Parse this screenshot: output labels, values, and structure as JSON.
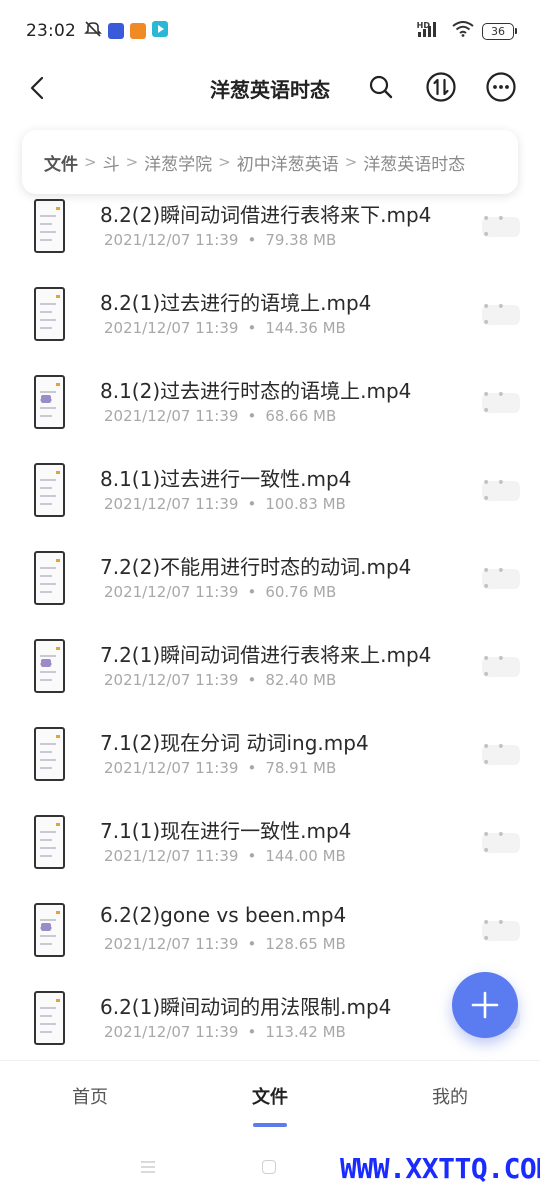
{
  "status_bar": {
    "time": "23:02",
    "network_label": "HD",
    "battery": "36",
    "icons": [
      "mute-icon",
      "app-notify-icon",
      "app-notify-icon-2",
      "play-store-icon",
      "signal-icon",
      "wifi-icon"
    ]
  },
  "title_bar": {
    "title": "洋葱英语时态",
    "icons": [
      "back-icon",
      "search-icon",
      "sort-icon",
      "more-icon"
    ]
  },
  "breadcrumb": {
    "items": [
      "文件",
      "斗",
      "洋葱学院",
      "初中洋葱英语",
      "洋葱英语时态"
    ],
    "separator": ">"
  },
  "files": [
    {
      "name": "8.2(2)瞬间动词借进行表将来下.mp4",
      "date": "2021/12/07 11:39",
      "size": "79.38 MB"
    },
    {
      "name": "8.2(1)过去进行的语境上.mp4",
      "date": "2021/12/07 11:39",
      "size": "144.36 MB"
    },
    {
      "name": "8.1(2)过去进行时态的语境上.mp4",
      "date": "2021/12/07 11:39",
      "size": "68.66 MB"
    },
    {
      "name": "8.1(1)过去进行一致性.mp4",
      "date": "2021/12/07 11:39",
      "size": "100.83 MB"
    },
    {
      "name": "7.2(2)不能用进行时态的动词.mp4",
      "date": "2021/12/07 11:39",
      "size": "60.76 MB"
    },
    {
      "name": "7.2(1)瞬间动词借进行表将来上.mp4",
      "date": "2021/12/07 11:39",
      "size": "82.40 MB"
    },
    {
      "name": "7.1(2)现在分词 动词ing.mp4",
      "date": "2021/12/07 11:39",
      "size": "78.91 MB"
    },
    {
      "name": "7.1(1)现在进行一致性.mp4",
      "date": "2021/12/07 11:39",
      "size": "144.00 MB"
    },
    {
      "name": "6.2(2)gone vs been.mp4",
      "date": "2021/12/07 11:39",
      "size": "128.65 MB"
    },
    {
      "name": "6.2(1)瞬间动词的用法限制.mp4",
      "date": "2021/12/07 11:39",
      "size": "113.42 MB"
    }
  ],
  "meta_separator": "•",
  "more_label": "• • •",
  "bottom_nav": {
    "items": [
      {
        "label": "首页",
        "active": false
      },
      {
        "label": "文件",
        "active": true
      },
      {
        "label": "我的",
        "active": false
      }
    ]
  },
  "watermark": "WWW.XXTTQ.COM",
  "colors": {
    "accent": "#5b7cf0",
    "watermark": "#1a2bff",
    "meta_text": "#a8a8a8"
  }
}
